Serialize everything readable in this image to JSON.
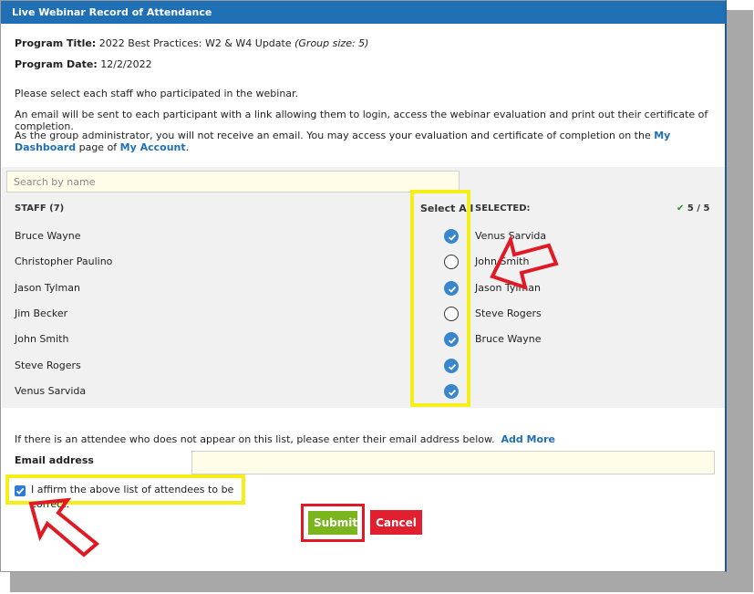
{
  "window": {
    "title": "Live Webinar Record of Attendance"
  },
  "program": {
    "title_label": "Program Title:",
    "title_value": "2022 Best Practices: W2 & W4 Update",
    "group_size": "(Group size: 5)",
    "date_label": "Program Date:",
    "date_value": "12/2/2022"
  },
  "instructions": {
    "line1": "Please select each staff who participated in the webinar.",
    "line2": "An email will be sent to each participant with a link allowing them to login, access the webinar evaluation and print out their certificate of completion.",
    "line3_pre": "As the group administrator, you will not receive an email. You may access your evaluation and certificate of completion on the",
    "dashboard_link": "My Dashboard",
    "line3_mid": "page of",
    "account_link": "My Account",
    "line3_end": "."
  },
  "search": {
    "placeholder": "Search by name"
  },
  "staff": {
    "header": "STAFF (7)",
    "select_all": "Select All",
    "members": [
      {
        "name": "Bruce Wayne",
        "checked": true
      },
      {
        "name": "Christopher Paulino",
        "checked": false
      },
      {
        "name": "Jason Tylman",
        "checked": true
      },
      {
        "name": "Jim Becker",
        "checked": false
      },
      {
        "name": "John Smith",
        "checked": true
      },
      {
        "name": "Steve Rogers",
        "checked": true
      },
      {
        "name": "Venus Sarvida",
        "checked": true
      }
    ]
  },
  "selected": {
    "header": "SELECTED:",
    "count": "5 / 5",
    "names": [
      "Venus Sarvida",
      "John Smith",
      "Jason Tylman",
      "Steve Rogers",
      "Bruce Wayne"
    ]
  },
  "extra": {
    "text": "If there is an attendee who does not appear on this list, please enter their email address below.",
    "add_more": "Add More",
    "email_label": "Email address"
  },
  "affirm": {
    "label": "I affirm the above list of attendees to be correct.",
    "checked": true
  },
  "buttons": {
    "submit": "Submit",
    "cancel": "Cancel"
  },
  "colors": {
    "title_bar": "#1f6fb5",
    "highlight": "#f6ee19",
    "annotation": "#e01a24",
    "submit": "#7ab51d",
    "check": "#3a86cc"
  }
}
